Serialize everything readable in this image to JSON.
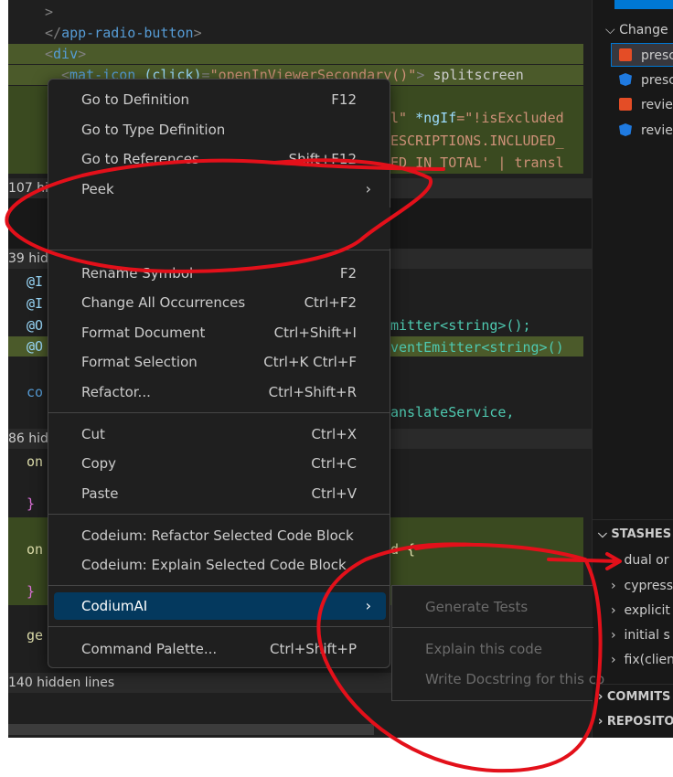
{
  "editor": {
    "lines": [
      {
        "text": ">"
      },
      {
        "close_tag": "app-radio-button"
      },
      {
        "open_tag": "div"
      },
      {
        "element": "mat-icon",
        "event": "(click)",
        "handler": "\"openInViewerSecondary()\"",
        "rest": "splitscreen"
      },
      {
        "text_a": "l\" ",
        "attr": "*ngIf",
        "val": "=\"!isExcluded"
      },
      {
        "text": "ESCRIPTIONS.INCLUDED_"
      },
      {
        "text": "ED_IN_TOTAL' | transl"
      },
      {
        "text": "mitter<string>();"
      },
      {
        "text": "ventEmitter<string>()"
      },
      {
        "text": "anslateService,"
      },
      {
        "text": "d {"
      }
    ],
    "hidden": {
      "h107": "107 hi",
      "h39": "39 hid",
      "h86": "86 hid",
      "h140": "140 hidden lines"
    },
    "gutter_tokens": {
      "at_i1": "@I",
      "at_i2": "@I",
      "at_o1": "@O",
      "at_o2": "@O",
      "co": "co",
      "on1": "on",
      "brace1": "}",
      "on2": "on",
      "brace2": "}",
      "ge": "ge"
    }
  },
  "context_menu": {
    "items": [
      {
        "label": "Go to Definition",
        "key": "F12"
      },
      {
        "label": "Go to Type Definition",
        "key": ""
      },
      {
        "label": "Go to References",
        "key": "Shift+F12"
      },
      {
        "label": "Peek",
        "key": ""
      },
      {
        "label": "Rename Symbol",
        "key": "F2"
      },
      {
        "label": "Change All Occurrences",
        "key": "Ctrl+F2"
      },
      {
        "label": "Format Document",
        "key": "Ctrl+Shift+I"
      },
      {
        "label": "Format Selection",
        "key": "Ctrl+K Ctrl+F"
      },
      {
        "label": "Refactor...",
        "key": "Ctrl+Shift+R"
      },
      {
        "label": "Cut",
        "key": "Ctrl+X"
      },
      {
        "label": "Copy",
        "key": "Ctrl+C"
      },
      {
        "label": "Paste",
        "key": "Ctrl+V"
      },
      {
        "label": "Codeium: Refactor Selected Code Block",
        "key": ""
      },
      {
        "label": "Codeium: Explain Selected Code Block",
        "key": ""
      },
      {
        "label": "CodiumAI",
        "key": ""
      },
      {
        "label": "Command Palette...",
        "key": "Ctrl+Shift+P"
      }
    ],
    "submenu_arrow": "›"
  },
  "submenu": {
    "items": [
      "Generate Tests",
      "Explain this code",
      "Write Docstring for this co"
    ]
  },
  "explorer": {
    "changes_header": "Change",
    "files": [
      {
        "name": "prescr",
        "icon": "html-file-icon"
      },
      {
        "name": "prescr",
        "icon": "angular-file-icon"
      },
      {
        "name": "review",
        "icon": "html-file-icon"
      },
      {
        "name": "review",
        "icon": "angular-file-icon"
      }
    ],
    "stashes_header": "STASHES (",
    "stashes": [
      "dual or",
      "cypress",
      "explicit",
      "initial s",
      "fix(clien"
    ],
    "commits_header": "COMMITS",
    "repos_header": "REPOSITO"
  },
  "colors": {
    "editor_bg": "#1f1f1f",
    "highlight_green": "#4b5a2a",
    "menu_active": "#04395e",
    "annotation_red": "#e3101a"
  }
}
